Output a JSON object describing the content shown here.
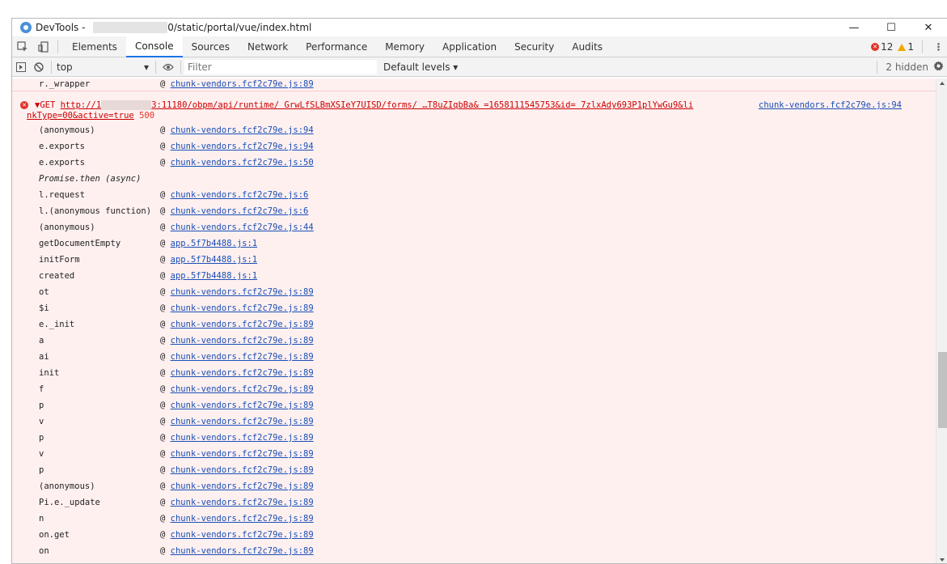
{
  "window": {
    "title_prefix": "DevTools - ",
    "title_suffix": "0/static/portal/vue/index.html",
    "controls": {
      "minimize": "—",
      "maximize": "☐",
      "close": "✕"
    }
  },
  "tabs": [
    "Elements",
    "Console",
    "Sources",
    "Network",
    "Performance",
    "Memory",
    "Application",
    "Security",
    "Audits"
  ],
  "active_tab": "Console",
  "status": {
    "errors": "12",
    "warnings": "1"
  },
  "console_toolbar": {
    "context": "top",
    "filter_placeholder": "Filter",
    "levels": "Default levels ▾",
    "hidden": "2 hidden"
  },
  "console": {
    "first_row": {
      "fn": "r._wrapper",
      "source": "chunk-vendors.fcf2c79e.js:89"
    },
    "error": {
      "prefix": "▼GET ",
      "url_a": "http://1",
      "url_b": "3:11180/obpm/api/runtime/  GrwLfSLBmXSIeY7UISD/forms/  …T8uZIqbBa& =1658111545753&id=  7zlxAdy693P1plYwGu9&li",
      "url_line2": "nkType=00&active=true",
      "status": "500",
      "source": "chunk-vendors.fcf2c79e.js:94"
    },
    "stack": [
      {
        "fn": "(anonymous)",
        "source": "chunk-vendors.fcf2c79e.js:94"
      },
      {
        "fn": "e.exports",
        "source": "chunk-vendors.fcf2c79e.js:94"
      },
      {
        "fn": "e.exports",
        "source": "chunk-vendors.fcf2c79e.js:50"
      },
      {
        "fn": "Promise.then (async)",
        "source": "",
        "italic": true
      },
      {
        "fn": "l.request",
        "source": "chunk-vendors.fcf2c79e.js:6"
      },
      {
        "fn": "l.(anonymous function)",
        "source": "chunk-vendors.fcf2c79e.js:6"
      },
      {
        "fn": "(anonymous)",
        "source": "chunk-vendors.fcf2c79e.js:44"
      },
      {
        "fn": "getDocumentEmpty",
        "source": "app.5f7b4488.js:1"
      },
      {
        "fn": "initForm",
        "source": "app.5f7b4488.js:1"
      },
      {
        "fn": "created",
        "source": "app.5f7b4488.js:1"
      },
      {
        "fn": "ot",
        "source": "chunk-vendors.fcf2c79e.js:89"
      },
      {
        "fn": "$i",
        "source": "chunk-vendors.fcf2c79e.js:89"
      },
      {
        "fn": "e._init",
        "source": "chunk-vendors.fcf2c79e.js:89"
      },
      {
        "fn": "a",
        "source": "chunk-vendors.fcf2c79e.js:89"
      },
      {
        "fn": "ai",
        "source": "chunk-vendors.fcf2c79e.js:89"
      },
      {
        "fn": "init",
        "source": "chunk-vendors.fcf2c79e.js:89"
      },
      {
        "fn": "f",
        "source": "chunk-vendors.fcf2c79e.js:89"
      },
      {
        "fn": "p",
        "source": "chunk-vendors.fcf2c79e.js:89"
      },
      {
        "fn": "v",
        "source": "chunk-vendors.fcf2c79e.js:89"
      },
      {
        "fn": "p",
        "source": "chunk-vendors.fcf2c79e.js:89"
      },
      {
        "fn": "v",
        "source": "chunk-vendors.fcf2c79e.js:89"
      },
      {
        "fn": "p",
        "source": "chunk-vendors.fcf2c79e.js:89"
      },
      {
        "fn": "(anonymous)",
        "source": "chunk-vendors.fcf2c79e.js:89"
      },
      {
        "fn": "Pi.e._update",
        "source": "chunk-vendors.fcf2c79e.js:89"
      },
      {
        "fn": "n",
        "source": "chunk-vendors.fcf2c79e.js:89"
      },
      {
        "fn": "on.get",
        "source": "chunk-vendors.fcf2c79e.js:89"
      },
      {
        "fn": "on",
        "source": "chunk-vendors.fcf2c79e.js:89"
      }
    ]
  },
  "icons": {
    "app": "devtools-icon",
    "inspect": "inspect-element-icon",
    "device": "device-toolbar-icon",
    "sidebar": "show-sidebar-icon",
    "clear": "clear-console-icon",
    "eye": "live-expression-icon",
    "settings": "gear-icon"
  },
  "colors": {
    "error_bg": "#fff0f0",
    "link": "#1a4fb5",
    "error_red": "#e0352b",
    "active_tab": "#1a73e8"
  }
}
